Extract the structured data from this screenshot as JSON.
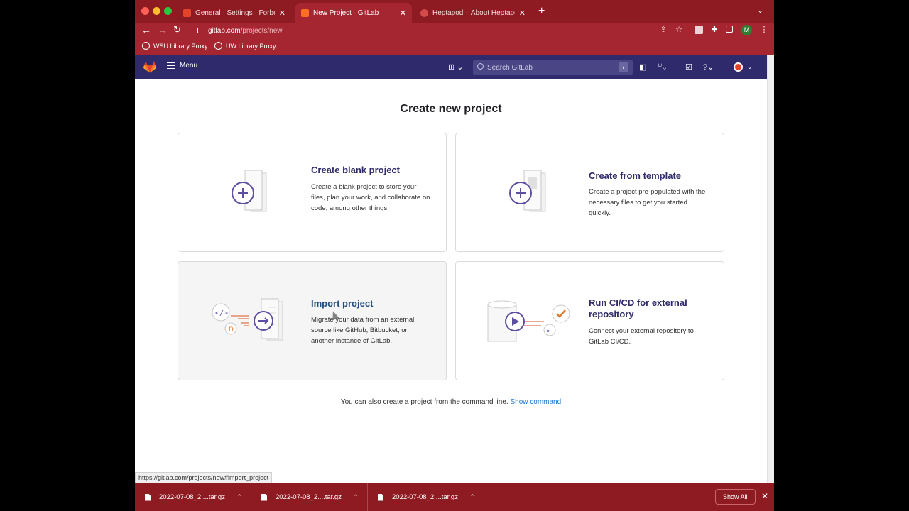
{
  "browser": {
    "tabs": [
      {
        "title": "General · Settings · Forbes Gro",
        "active": false
      },
      {
        "title": "New Project · GitLab",
        "active": true
      },
      {
        "title": "Heptapod – About Heptapod",
        "active": false
      }
    ],
    "url_host": "gitlab.com",
    "url_path": "/projects/new",
    "profile_initial": "M",
    "bookmarks": [
      "WSU Library Proxy",
      "UW Library Proxy"
    ]
  },
  "gitlab": {
    "menu_label": "Menu",
    "search_placeholder": "Search GitLab",
    "search_shortcut": "/"
  },
  "main": {
    "title": "Create new project",
    "cards": [
      {
        "title": "Create blank project",
        "desc": "Create a blank project to store your files, plan your work, and collaborate on code, among other things."
      },
      {
        "title": "Create from template",
        "desc": "Create a project pre-populated with the necessary files to get you started quickly."
      },
      {
        "title": "Import project",
        "desc": "Migrate your data from an external source like GitHub, Bitbucket, or another instance of GitLab."
      },
      {
        "title": "Run CI/CD for external repository",
        "desc": "Connect your external repository to GitLab CI/CD."
      }
    ],
    "cmdline_text": "You can also create a project from the command line.",
    "cmdline_link": "Show command"
  },
  "status_url": "https://gitlab.com/projects/new#import_project",
  "downloads": {
    "items": [
      "2022-07-08_2....tar.gz",
      "2022-07-08_2....tar.gz",
      "2022-07-08_2....tar.gz"
    ],
    "show_all": "Show All"
  },
  "colors": {
    "gitlab_header": "#2f2a6b",
    "browser_frame": "#8e1a22",
    "link": "#1f75cb",
    "brand": "#e24329"
  }
}
